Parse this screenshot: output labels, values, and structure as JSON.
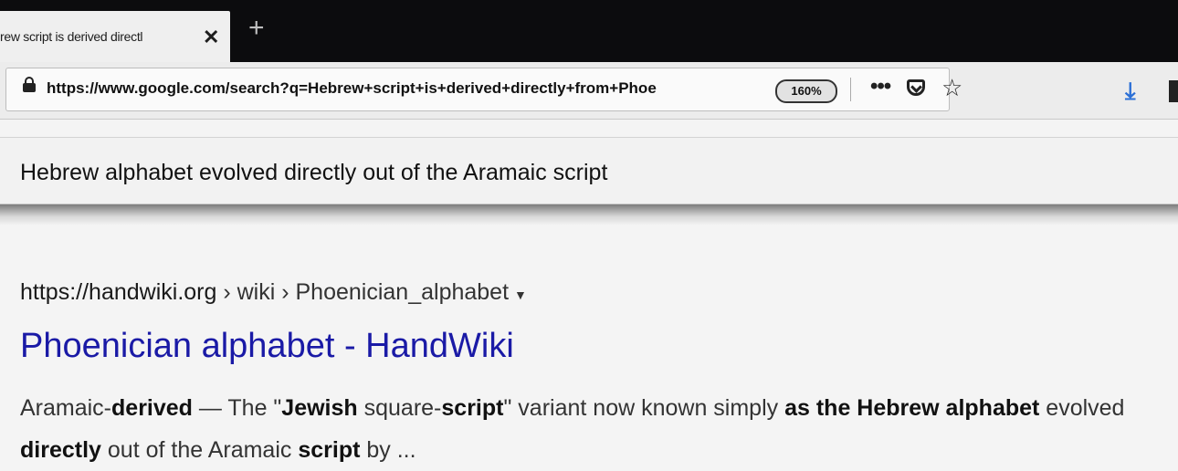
{
  "tab": {
    "title": "rew script is derived directl",
    "close_glyph": "✕",
    "new_tab_glyph": "+"
  },
  "navbar": {
    "url": "https://www.google.com/search?q=Hebrew+script+is+derived+directly+from+Phoe",
    "zoom": "160%",
    "menu_glyph": "•••",
    "star_glyph": "☆",
    "download_glyph": "⤓",
    "icons": [
      "lock-icon",
      "pocket-icon",
      "bookmark-star-icon",
      "download-icon",
      "library-icon"
    ]
  },
  "answer": {
    "text": "Hebrew alphabet evolved directly out of the Aramaic script"
  },
  "result": {
    "cite_host": "https://handwiki.org",
    "cite_path": " › wiki › Phoenician_alphabet",
    "caret": "▼",
    "title": "Phoenician alphabet - HandWiki",
    "snippet": [
      {
        "text": "Aramaic-",
        "bold": false
      },
      {
        "text": "derived",
        "bold": true
      },
      {
        "text": " — The \"",
        "bold": false
      },
      {
        "text": "Jewish",
        "bold": true
      },
      {
        "text": " square-",
        "bold": false
      },
      {
        "text": "script",
        "bold": true
      },
      {
        "text": "\" variant now known simply ",
        "bold": false
      },
      {
        "text": "as the Hebrew alphabet",
        "bold": true
      },
      {
        "text": " evolved ",
        "bold": false
      },
      {
        "text": "directly",
        "bold": true
      },
      {
        "text": " out of the Aramaic ",
        "bold": false
      },
      {
        "text": "script",
        "bold": true
      },
      {
        "text": " by ...",
        "bold": false
      }
    ]
  },
  "colors": {
    "link": "#1a1aa6",
    "download": "#2b6fd6",
    "tabstrip": "#0c0c0e"
  }
}
